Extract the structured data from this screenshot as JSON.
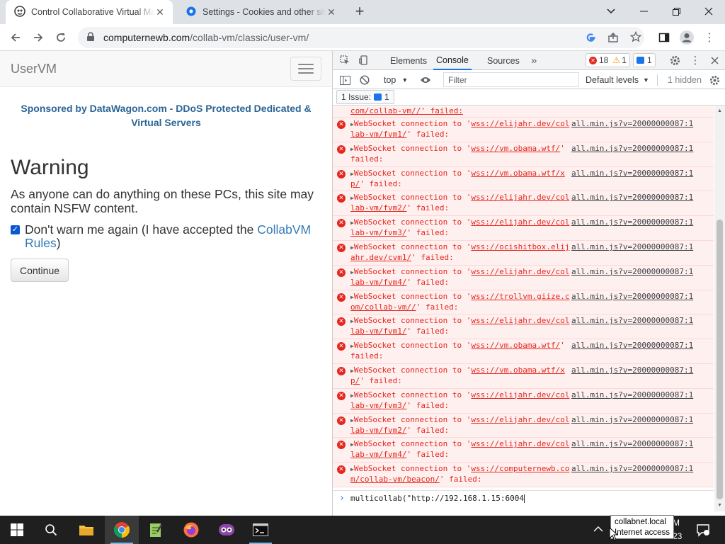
{
  "browser": {
    "tabs": [
      {
        "title": "Control Collaborative Virtual Machines",
        "active": true
      },
      {
        "title": "Settings - Cookies and other site data",
        "active": false
      }
    ],
    "url_host": "computernewb.com",
    "url_path": "/collab-vm/classic/user-vm/"
  },
  "page": {
    "brand": "UserVM",
    "sponsor": "Sponsored by DataWagon.com - DDoS Protected Dedicated & Virtual Servers",
    "warning_title": "Warning",
    "warning_text": "As anyone can do anything on these PCs, this site may contain NSFW content.",
    "checkbox_text": "Don't warn me again (I have accepted the ",
    "checkbox_link": "CollabVM Rules",
    "checkbox_tail": ")",
    "continue_label": "Continue"
  },
  "devtools": {
    "tabs": [
      "Elements",
      "Console",
      "Sources"
    ],
    "active_tab": "Console",
    "error_count": "18",
    "warning_count": "1",
    "message_count": "1",
    "context": "top",
    "filter_placeholder": "Filter",
    "levels": "Default levels",
    "hidden": "1 hidden",
    "issues_label": "1 Issue:",
    "issues_count": "1",
    "first_line": "com/collab-vm//' failed:",
    "source": "all.min.js?v=20000000087:1",
    "messages": [
      {
        "pre": "WebSocket connection to '",
        "url": "wss://elijahr.dev/collab-vm/fvm1/",
        "post": "' failed:"
      },
      {
        "pre": "WebSocket connection to '",
        "url": "wss://vm.obama.wtf/",
        "post": "' failed:"
      },
      {
        "pre": "WebSocket connection to '",
        "url": "wss://vm.obama.wtf/xp/",
        "post": "' failed:"
      },
      {
        "pre": "WebSocket connection to '",
        "url": "wss://elijahr.dev/collab-vm/fvm2/",
        "post": "' failed:"
      },
      {
        "pre": "WebSocket connection to '",
        "url": "wss://elijahr.dev/collab-vm/fvm3/",
        "post": "' failed:"
      },
      {
        "pre": "WebSocket connection to '",
        "url": "wss://ocishitbox.elijahr.dev/cvm1/",
        "post": "' failed:"
      },
      {
        "pre": "WebSocket connection to '",
        "url": "wss://elijahr.dev/collab-vm/fvm4/",
        "post": "' failed:"
      },
      {
        "pre": "WebSocket connection to '",
        "url": "wss://trollvm.giize.com/collab-vm//",
        "post": "' failed:"
      },
      {
        "pre": "WebSocket connection to '",
        "url": "wss://elijahr.dev/collab-vm/fvm1/",
        "post": "' failed:"
      },
      {
        "pre": "WebSocket connection to '",
        "url": "wss://vm.obama.wtf/",
        "post": "' failed:"
      },
      {
        "pre": "WebSocket connection to '",
        "url": "wss://vm.obama.wtf/xp/",
        "post": "' failed:"
      },
      {
        "pre": "WebSocket connection to '",
        "url": "wss://elijahr.dev/collab-vm/fvm3/",
        "post": "' failed:"
      },
      {
        "pre": "WebSocket connection to '",
        "url": "wss://elijahr.dev/collab-vm/fvm2/",
        "post": "' failed:"
      },
      {
        "pre": "WebSocket connection to '",
        "url": "wss://elijahr.dev/collab-vm/fvm4/",
        "post": "' failed:"
      },
      {
        "pre": "WebSocket connection to '",
        "url": "wss://computernewb.com/collab-vm/beacon/",
        "post": "' failed:"
      }
    ],
    "prompt_input": "multicollab(\"http://192.168.1.15:6004"
  },
  "taskbar": {
    "apps": [
      "start-icon",
      "search-icon",
      "file-explorer-icon",
      "chrome-icon",
      "notepad-icon",
      "firefox-icon",
      "app-icon",
      "terminal-icon"
    ],
    "tooltip_line1": "collabnet.local",
    "tooltip_line2": "Internet access",
    "clock_frag1": "M",
    "clock_frag2": "23"
  },
  "colors": {
    "accent": "#1a73e8",
    "error": "#e5261d",
    "link": "#337ab7",
    "sponsor": "#2a6496"
  }
}
